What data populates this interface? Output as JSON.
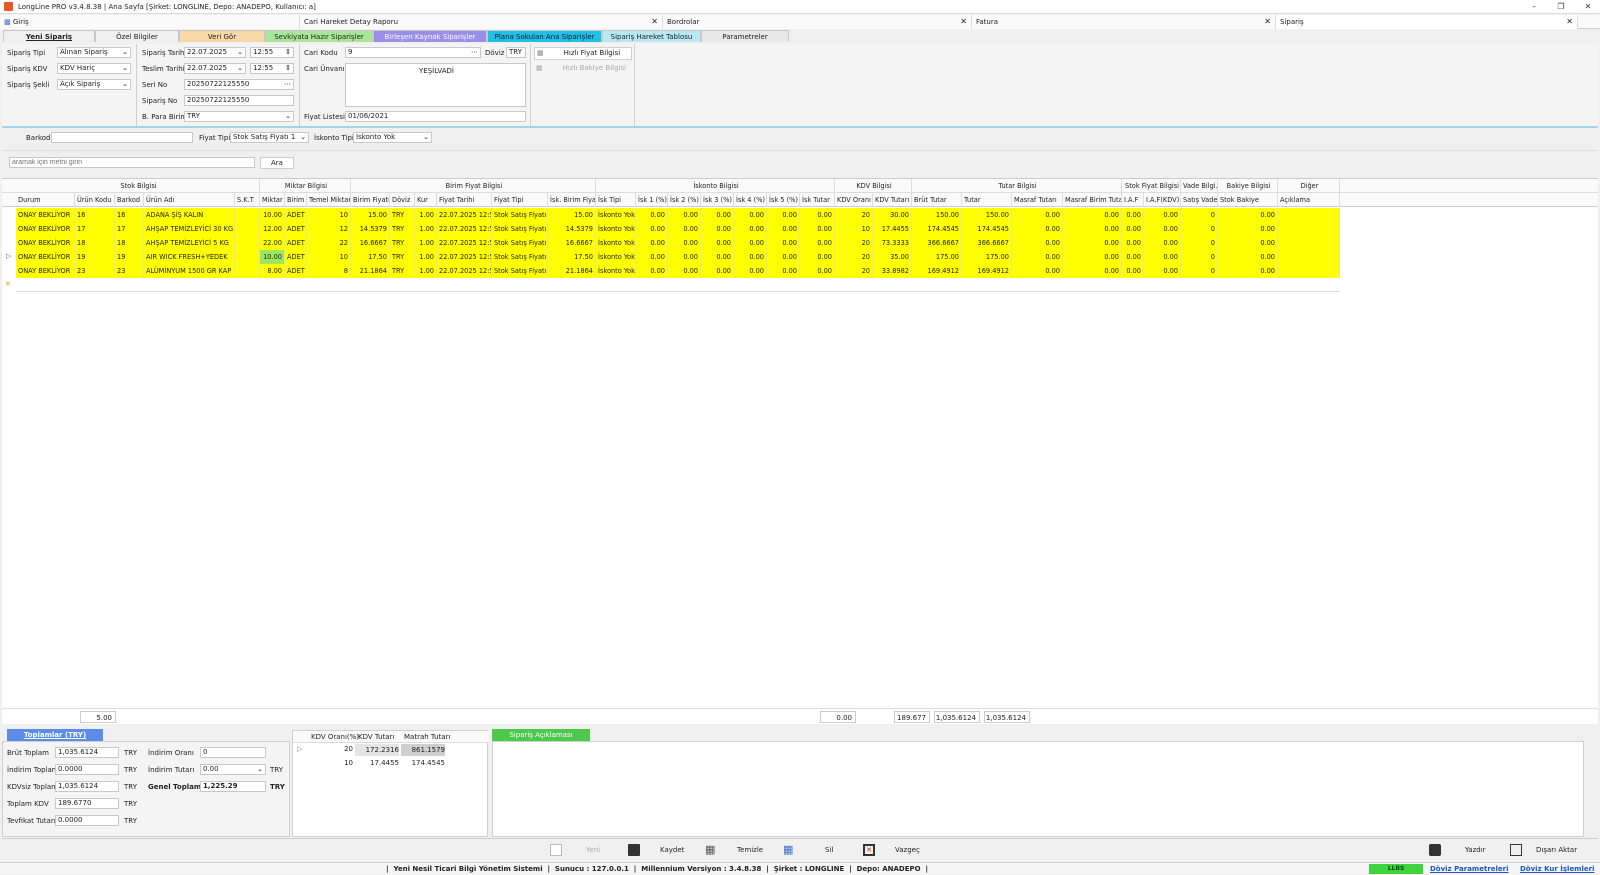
{
  "window": {
    "title": "LongLine PRO v3.4.8.38 | Ana Sayfa [Şirket: LONGLINE, Depo: ANADEPO, Kullanıcı: a]"
  },
  "doc_tabs": [
    {
      "label": "Giriş"
    },
    {
      "label": "Cari Hareket Detay Raporu"
    },
    {
      "label": "Bordrolar"
    },
    {
      "label": "Fatura"
    },
    {
      "label": "Sipariş"
    }
  ],
  "sub_tabs": [
    {
      "label": "Yeni Sipariş",
      "color": "#f0f0f0"
    },
    {
      "label": "Özel Bilgiler",
      "color": "#f0f0f0"
    },
    {
      "label": "Veri Gör",
      "color": "#f9d8a8"
    },
    {
      "label": "Sevkiyata Hazır Siparişler",
      "color": "#a9e69a"
    },
    {
      "label": "Birleşen Kaynak Siparişler",
      "color": "#9b8ee8"
    },
    {
      "label": "Plana Sokulan Ana Siparişler",
      "color": "#1fbfe8"
    },
    {
      "label": "Sipariş Hareket Tablosu",
      "color": "#b8e8f0"
    },
    {
      "label": "Parametreler",
      "color": "#e8e8e8"
    }
  ],
  "form": {
    "siparis_tipi_label": "Sipariş Tipi",
    "siparis_tipi": "Alınan Sipariş",
    "siparis_kdv_label": "Sipariş KDV",
    "siparis_kdv": "KDV Hariç",
    "siparis_sekli_label": "Sipariş Şekli",
    "siparis_sekli": "Açık Sipariş",
    "siparis_tarihi_label": "Sipariş Tarihi",
    "siparis_tarihi": "22.07.2025",
    "siparis_saat": "12:55",
    "teslim_tarihi_label": "Teslim Tarihi",
    "teslim_tarihi": "22.07.2025",
    "teslim_saat": "12:55",
    "seri_no_label": "Seri No",
    "seri_no": "20250722125550",
    "siparis_no_label": "Sipariş No",
    "siparis_no": "20250722125550",
    "para_birimi_label": "B. Para Birimi",
    "para_birimi": "TRY",
    "cari_kodu_label": "Cari Kodu",
    "cari_kodu": "9",
    "doviz_label": "Döviz",
    "doviz": "TRY",
    "cari_unvani_label": "Cari Ünvanı",
    "cari_unvani": "YEŞİLVADİ",
    "fiyat_listesi_label": "Fiyat Listesi",
    "fiyat_listesi": "01/06/2021",
    "hizli_fiyat": "Hızlı Fiyat Bilgisi",
    "hizli_bakiye": "Hızlı Bakiye Bilgisi",
    "barkod_label": "Barkod",
    "fiyat_tipi_label": "Fiyat Tipi",
    "fiyat_tipi": "Stok Satış Fiyatı 1",
    "iskonto_tipi_label": "İskonto Tipi",
    "iskonto_tipi": "İskonto Yok",
    "search_placeholder": "aramak için metni girin",
    "ara_button": "Ara"
  },
  "grid": {
    "groups": [
      "Stok Bilgisi",
      "Miktar Bilgisi",
      "Birim Fiyat Bilgisi",
      "İskonto Bilgisi",
      "KDV Bilgisi",
      "Tutar Bilgisi",
      "Stok Fiyat Bilgisi",
      "Vade Bilgi...",
      "Bakiye Bilgisi",
      "Diğer"
    ],
    "columns": [
      "Durum",
      "Ürün Kodu",
      "Barkod",
      "Ürün Adı",
      "S.K.T",
      "Miktar",
      "Birim",
      "Temel Miktar",
      "Birim Fiyatı",
      "Döviz",
      "Kur",
      "Fiyat Tarihi",
      "Fiyat Tipi",
      "İsk. Birim Fiyat",
      "İsk Tipi",
      "İsk 1 (%)",
      "İsk 2 (%)",
      "İsk 3 (%)",
      "İsk 4 (%)",
      "İsk 5 (%)",
      "İsk Tutar",
      "KDV Oranı",
      "KDV Tutarı",
      "Brüt Tutar",
      "Tutar",
      "Masraf Tutarı",
      "Masraf Birim Tutarı",
      "I.A.F",
      "I.A.F(KDV)",
      "Satış Vade",
      "Stok Bakiye",
      "Açıklama"
    ],
    "rows": [
      [
        "ONAY BEKLİYOR",
        "16",
        "16",
        "ADANA ŞİŞ KALIN",
        "",
        "10.00",
        "ADET",
        "10",
        "15.00",
        "TRY",
        "1.00",
        "22.07.2025 12:55",
        "Stok Satış Fiyatı 1",
        "15.00",
        "İskonto Yok",
        "0.00",
        "0.00",
        "0.00",
        "0.00",
        "0.00",
        "0.00",
        "20",
        "30.00",
        "150.00",
        "150.00",
        "0.00",
        "0.00",
        "0.00",
        "0.00",
        "0",
        "0.00",
        ""
      ],
      [
        "ONAY BEKLİYOR",
        "17",
        "17",
        "AHŞAP TEMİZLEYİCİ 30 KG",
        "",
        "12.00",
        "ADET",
        "12",
        "14.5379",
        "TRY",
        "1.00",
        "22.07.2025 12:56",
        "Stok Satış Fiyatı 1",
        "14.5379",
        "İskonto Yok",
        "0.00",
        "0.00",
        "0.00",
        "0.00",
        "0.00",
        "0.00",
        "10",
        "17.4455",
        "174.4545",
        "174.4545",
        "0.00",
        "0.00",
        "0.00",
        "0.00",
        "0",
        "0.00",
        ""
      ],
      [
        "ONAY BEKLİYOR",
        "18",
        "18",
        "AHŞAP TEMİZLEYİCİ 5 KG",
        "",
        "22.00",
        "ADET",
        "22",
        "16.6667",
        "TRY",
        "1.00",
        "22.07.2025 12:56",
        "Stok Satış Fiyatı 1",
        "16.6667",
        "İskonto Yok",
        "0.00",
        "0.00",
        "0.00",
        "0.00",
        "0.00",
        "0.00",
        "20",
        "73.3333",
        "366.6667",
        "366.6667",
        "0.00",
        "0.00",
        "0.00",
        "0.00",
        "0",
        "0.00",
        ""
      ],
      [
        "ONAY BEKLİYOR",
        "19",
        "19",
        "AIR WICK FRESH+YEDEK",
        "",
        "10.00",
        "ADET",
        "10",
        "17.50",
        "TRY",
        "1.00",
        "22.07.2025 12:56",
        "Stok Satış Fiyatı 1",
        "17.50",
        "İskonto Yok",
        "0.00",
        "0.00",
        "0.00",
        "0.00",
        "0.00",
        "0.00",
        "20",
        "35.00",
        "175.00",
        "175.00",
        "0.00",
        "0.00",
        "0.00",
        "0.00",
        "0",
        "0.00",
        ""
      ],
      [
        "ONAY BEKLİYOR",
        "23",
        "23",
        "ALÜMİNYUM 1500 GR KAP",
        "",
        "8.00",
        "ADET",
        "8",
        "21.1864",
        "TRY",
        "1.00",
        "22.07.2025 12:56",
        "Stok Satış Fiyatı 1",
        "21.1864",
        "İskonto Yok",
        "0.00",
        "0.00",
        "0.00",
        "0.00",
        "0.00",
        "0.00",
        "20",
        "33.8982",
        "169.4912",
        "169.4912",
        "0.00",
        "0.00",
        "0.00",
        "0.00",
        "0",
        "0.00",
        ""
      ]
    ],
    "row_color": "#ffff00"
  },
  "summary": {
    "miktar": "5.00",
    "isk_tutar": "0.00",
    "kdv_tutari": "189.677",
    "brut_tutar": "1,035.6124",
    "tutar": "1,035.6124"
  },
  "totals": {
    "tab_label": "Toplamlar (TRY)",
    "brut_label": "Brüt Toplam",
    "brut": "1,035.6124",
    "indirim_label": "İndirim Toplamı",
    "indirim": "0.0000",
    "kdvsiz_label": "KDVsiz Toplam",
    "kdvsiz": "1,035.6124",
    "kdv_label": "Toplam KDV",
    "kdv": "189.6770",
    "tevkifat_label": "Tevfikat Tutarı",
    "tevkifat": "0.0000",
    "currency": "TRY",
    "indirim_orani_label": "İndirim Oranı",
    "indirim_orani": "0",
    "indirim_tutari_label": "İndirim Tutarı",
    "indirim_tutari": "0.00",
    "genel_label": "Genel Toplam",
    "genel": "1,225.29"
  },
  "kdv_table": {
    "headers": [
      "KDV Oranı(%)",
      "KDV Tutarı",
      "Matrah Tutarı"
    ],
    "rows": [
      [
        "20",
        "172.2316",
        "861.1579"
      ],
      [
        "10",
        "17.4455",
        "174.4545"
      ]
    ]
  },
  "aciklama": {
    "tab_label": "Sipariş Açıklaması"
  },
  "actions": {
    "yeni": "Yeni",
    "kaydet": "Kaydet",
    "temizle": "Temizle",
    "sil": "Sil",
    "vazgec": "Vazgeç",
    "yazdir": "Yazdır",
    "disari": "Dışarı Aktar"
  },
  "status": {
    "sistem": "Yeni Nesil Ticari Bilgi Yönetim Sistemi",
    "sunucu": "Sunucu :  127.0.0.1",
    "versiyon": "Millennium Versiyon :  3.4.8.38",
    "sirket": "Şirket :  LONGLINE",
    "depo": "Depo:  ANADEPO",
    "badge": "LLBS",
    "doviz_param": "Döviz Parametreleri",
    "doviz_kur": "Döviz Kur İşlemleri"
  }
}
